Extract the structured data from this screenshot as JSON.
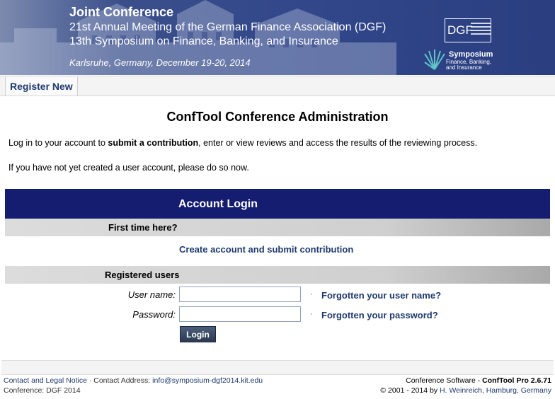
{
  "banner": {
    "title": "Joint Conference",
    "subtitle1": "21st Annual Meeting of the German Finance Association (DGF)",
    "subtitle2": "13th Symposium on Finance, Banking, and Insurance",
    "place_date": "Karlsruhe, Germany, December 19-20, 2014",
    "dgf_logo_text": "DGF",
    "symposium_logo_title": "Symposium",
    "symposium_logo_sub": "Finance, Banking, and Insurance"
  },
  "nav": {
    "register_new": "Register New"
  },
  "main": {
    "heading": "ConfTool Conference Administration",
    "intro_part1": "Log in to your account to ",
    "intro_bold": "submit a contribution",
    "intro_part2": ", enter or view reviews and access the results of the reviewing process.",
    "intro_line2": "If you have not yet created a user account, please do so now."
  },
  "login": {
    "header": "Account Login",
    "first_time_label": "First time here?",
    "create_link": "Create account and submit contribution",
    "registered_label": "Registered users",
    "username_label": "User name:",
    "password_label": "Password:",
    "username_value": "",
    "password_value": "",
    "forgot_username": "Forgotten your user name?",
    "forgot_password": "Forgotten your password?",
    "separator": "·",
    "login_button": "Login"
  },
  "footer": {
    "contact_legal": "Contact and Legal Notice",
    "contact_address_label": " · Contact Address: ",
    "contact_email": "info@symposium-dgf2014.kit.edu",
    "conference_label": "Conference: DGF 2014",
    "software_prefix": "Conference Software - ",
    "software_name": "ConfTool Pro 2.6.71",
    "copyright_prefix": "© 2001 - 2014 by ",
    "copyright_author": "H. Weinreich, Hamburg, Germany"
  },
  "colors": {
    "banner_blue": "#2e4385",
    "login_header_navy": "#141d6f",
    "link_blue": "#1f3a6e"
  }
}
